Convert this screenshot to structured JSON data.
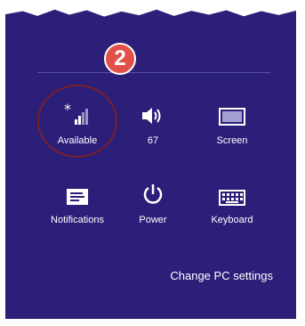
{
  "callout_number": "2",
  "tiles": [
    {
      "label": "Available",
      "icon": "network-signal-icon"
    },
    {
      "label": "67",
      "icon": "volume-icon"
    },
    {
      "label": "Screen",
      "icon": "screen-brightness-icon"
    },
    {
      "label": "Notifications",
      "icon": "notifications-icon"
    },
    {
      "label": "Power",
      "icon": "power-icon"
    },
    {
      "label": "Keyboard",
      "icon": "keyboard-icon"
    }
  ],
  "change_pc_settings": "Change PC settings",
  "colors": {
    "panel_bg": "#2b1f7a",
    "badge_bg": "#e2504a",
    "highlight_ring": "#7a1f2a"
  }
}
